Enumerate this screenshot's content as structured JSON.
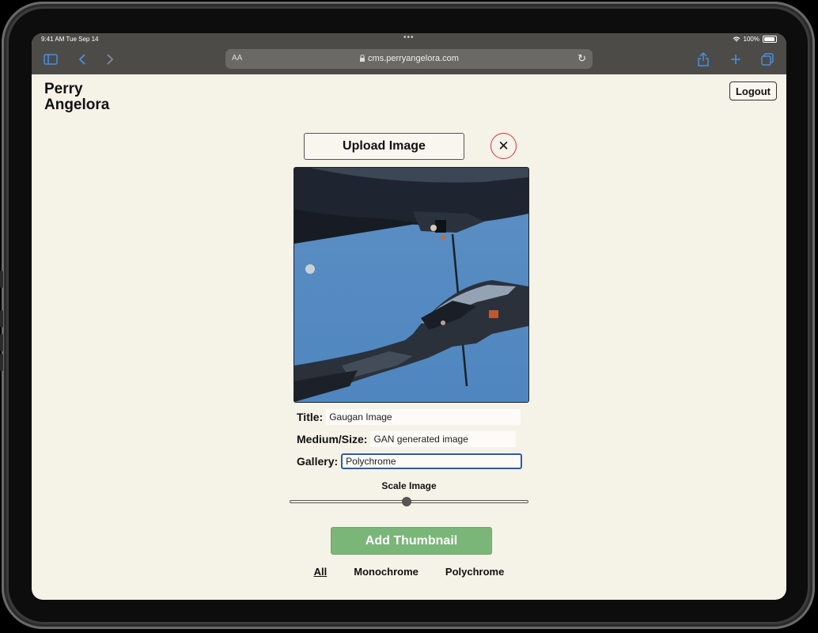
{
  "status": {
    "time": "9:41 AM  Tue Sep 14",
    "battery": "100%"
  },
  "browser": {
    "text_size": "AA",
    "url": "cms.perryangelora.com"
  },
  "page": {
    "brand_line1": "Perry",
    "brand_line2": "Angelora",
    "logout_label": "Logout",
    "upload_label": "Upload Image",
    "close_symbol": "✕"
  },
  "form": {
    "title_label": "Title:",
    "title_value": "Gaugan Image",
    "medium_label": "Medium/Size:",
    "medium_value": "GAN generated image",
    "gallery_label": "Gallery:",
    "gallery_value": "Polychrome"
  },
  "scale": {
    "label": "Scale Image",
    "value_fraction": 0.49
  },
  "actions": {
    "add_thumbnail_label": "Add Thumbnail"
  },
  "filters": {
    "items": [
      "All",
      "Monochrome",
      "Polychrome"
    ],
    "active": "All"
  },
  "colors": {
    "page_background": "#f5f2e8",
    "accent_green": "#7bb679",
    "close_ring": "#d33333",
    "focus_blue": "#2b5ca8",
    "browser_blue": "#4a90e2"
  },
  "icons": {
    "sidebar": "sidebar-icon",
    "back": "chevron-left-icon",
    "forward": "chevron-right-icon",
    "reload": "reload-icon",
    "share": "share-icon",
    "new_tab": "plus-icon",
    "tabs": "tabs-icon",
    "close": "close-icon"
  }
}
